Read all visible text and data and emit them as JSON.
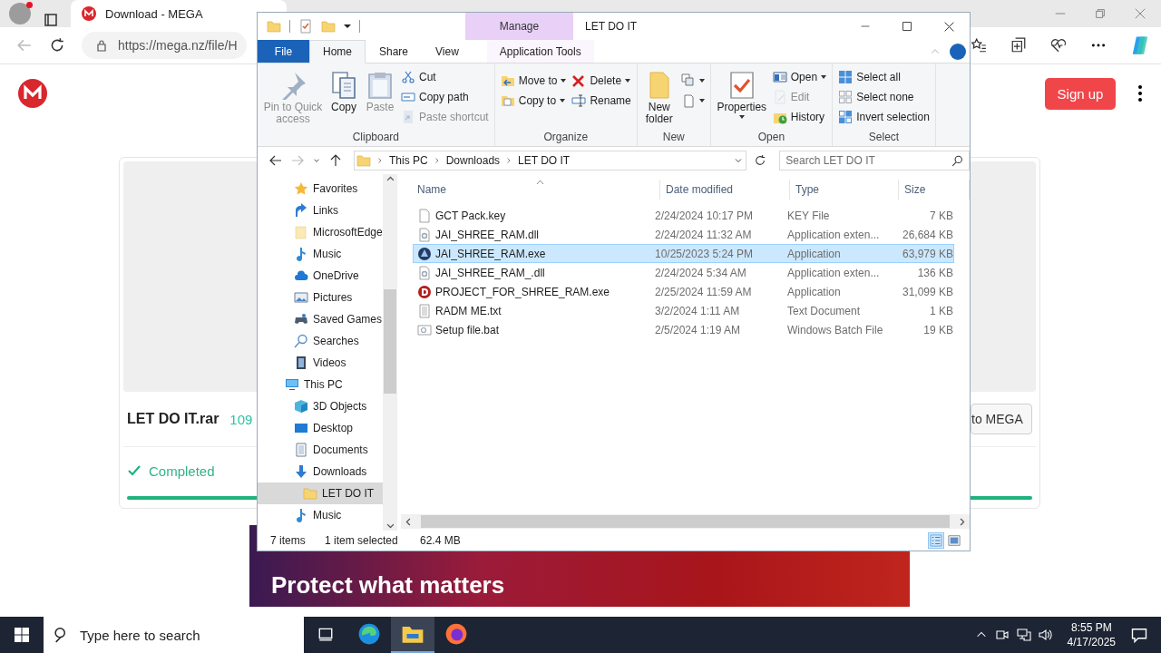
{
  "browser": {
    "tab": {
      "title": "Download - MEGA"
    },
    "address": "https://mega.nz/file/H",
    "page": {
      "signup": "Sign up",
      "file_name": "LET DO IT.rar",
      "file_size": "109",
      "save_button": "to MEGA",
      "status": "Completed",
      "progress": {
        "level": 1
      },
      "banner": "Protect what matters"
    }
  },
  "explorer": {
    "title": "LET DO IT",
    "context_label": "Manage",
    "tabs": [
      {
        "label": "File",
        "kind": "file",
        "selected": false
      },
      {
        "label": "Home",
        "kind": "plain",
        "selected": true
      },
      {
        "label": "Share",
        "kind": "plain",
        "selected": false
      },
      {
        "label": "View",
        "kind": "plain",
        "selected": false
      },
      {
        "label": "Application Tools",
        "kind": "context",
        "selected": false
      }
    ],
    "ribbon": [
      {
        "label": "Clipboard",
        "columns": [
          {
            "kind": "large",
            "items": [
              {
                "label": "Pin to Quick access",
                "kind": "pin",
                "disabled": true,
                "dropdown": false
              }
            ]
          },
          {
            "kind": "large",
            "items": [
              {
                "label": "Copy",
                "kind": "copy",
                "disabled": false,
                "dropdown": false
              }
            ]
          },
          {
            "kind": "large",
            "items": [
              {
                "label": "Paste",
                "kind": "paste",
                "disabled": true,
                "dropdown": false
              }
            ]
          },
          {
            "kind": "stack",
            "items": [
              {
                "label": "Cut",
                "kind": "cut",
                "disabled": false,
                "dropdown": false
              },
              {
                "label": "Copy path",
                "kind": "copypath",
                "disabled": false,
                "dropdown": false
              },
              {
                "label": "Paste shortcut",
                "kind": "pasteshortcut",
                "disabled": true,
                "dropdown": false
              }
            ]
          }
        ]
      },
      {
        "label": "Organize",
        "columns": [
          {
            "kind": "stack",
            "items": [
              {
                "label": "Move to",
                "kind": "moveto",
                "disabled": false,
                "dropdown": true
              },
              {
                "label": "Copy to",
                "kind": "copyto",
                "disabled": false,
                "dropdown": true
              }
            ]
          },
          {
            "kind": "stack",
            "items": [
              {
                "label": "Delete",
                "kind": "delete",
                "disabled": false,
                "dropdown": true
              },
              {
                "label": "Rename",
                "kind": "rename",
                "disabled": false,
                "dropdown": false
              }
            ]
          }
        ]
      },
      {
        "label": "New",
        "columns": [
          {
            "kind": "large",
            "items": [
              {
                "label": "New folder",
                "kind": "newfolder",
                "disabled": false,
                "dropdown": false
              }
            ]
          },
          {
            "kind": "stack",
            "items": [
              {
                "kind": "newitem",
                "disabled": false,
                "dropdown": true
              },
              {
                "kind": "easyaccess",
                "disabled": false,
                "dropdown": true
              }
            ]
          }
        ]
      },
      {
        "label": "Open",
        "columns": [
          {
            "kind": "large",
            "items": [
              {
                "label": "Properties",
                "kind": "properties",
                "disabled": false,
                "dropdown": true
              }
            ]
          },
          {
            "kind": "stack",
            "items": [
              {
                "label": "Open",
                "kind": "open",
                "disabled": false,
                "dropdown": true
              },
              {
                "label": "Edit",
                "kind": "edit",
                "disabled": true,
                "dropdown": false
              },
              {
                "label": "History",
                "kind": "history",
                "disabled": false,
                "dropdown": false
              }
            ]
          }
        ]
      },
      {
        "label": "Select",
        "columns": [
          {
            "kind": "stack",
            "items": [
              {
                "label": "Select all",
                "kind": "selectall",
                "disabled": false,
                "dropdown": false
              },
              {
                "label": "Select none",
                "kind": "selectnone",
                "disabled": false,
                "dropdown": false
              },
              {
                "label": "Invert selection",
                "kind": "invert",
                "disabled": false,
                "dropdown": false
              }
            ]
          }
        ]
      }
    ],
    "breadcrumbs": [
      "This PC",
      "Downloads",
      "LET DO IT"
    ],
    "search": {
      "placeholder": "Search LET DO IT"
    },
    "nav_pane": {
      "partial_group": [
        {
          "label": "Favorites",
          "kind": "star",
          "selected": false
        },
        {
          "label": "Links",
          "kind": "link",
          "selected": false
        },
        {
          "label": "MicrosoftEdge",
          "kind": "folderlight",
          "selected": false
        },
        {
          "label": "Music",
          "kind": "music",
          "selected": false
        },
        {
          "label": "OneDrive",
          "kind": "cloud",
          "selected": false
        },
        {
          "label": "Pictures",
          "kind": "pictures",
          "selected": false
        },
        {
          "label": "Saved Games",
          "kind": "games",
          "selected": false
        },
        {
          "label": "Searches",
          "kind": "searches",
          "selected": false
        },
        {
          "label": "Videos",
          "kind": "video",
          "selected": false
        }
      ],
      "items": [
        {
          "label": "This PC",
          "kind": "pc",
          "selected": false,
          "children": [
            {
              "label": "3D Objects",
              "kind": "cube",
              "selected": false
            },
            {
              "label": "Desktop",
              "kind": "desktop",
              "selected": false
            },
            {
              "label": "Documents",
              "kind": "docs",
              "selected": false
            },
            {
              "label": "Downloads",
              "kind": "downloads",
              "selected": false,
              "children": [
                {
                  "label": "LET DO IT",
                  "kind": "folder",
                  "selected": true
                }
              ]
            },
            {
              "label": "Music",
              "kind": "music",
              "selected": false
            }
          ]
        }
      ]
    },
    "columns": [
      {
        "label": "Name",
        "sorted": true
      },
      {
        "label": "Date modified",
        "sorted": false
      },
      {
        "label": "Type",
        "sorted": false
      },
      {
        "label": "Size",
        "sorted": false
      }
    ],
    "files": [
      {
        "name": "GCT Pack.key",
        "date": "2/24/2024 10:17 PM",
        "type": "KEY File",
        "size": "7 KB",
        "kind": "blank",
        "selected": false
      },
      {
        "name": "JAI_SHREE_RAM.dll",
        "date": "2/24/2024 11:32 AM",
        "type": "Application exten...",
        "size": "26,684 KB",
        "kind": "dll",
        "selected": false
      },
      {
        "name": "JAI_SHREE_RAM.exe",
        "date": "10/25/2023 5:24 PM",
        "type": "Application",
        "size": "63,979 KB",
        "kind": "exe",
        "selected": true
      },
      {
        "name": "JAI_SHREE_RAM_.dll",
        "date": "2/24/2024 5:34 AM",
        "type": "Application exten...",
        "size": "136 KB",
        "kind": "dll",
        "selected": false
      },
      {
        "name": "PROJECT_FOR_SHREE_RAM.exe",
        "date": "2/25/2024 11:59 AM",
        "type": "Application",
        "size": "31,099 KB",
        "kind": "exealt",
        "selected": false
      },
      {
        "name": "RADM ME.txt",
        "date": "3/2/2024 1:11 AM",
        "type": "Text Document",
        "size": "1 KB",
        "kind": "txt",
        "selected": false
      },
      {
        "name": "Setup file.bat",
        "date": "2/5/2024 1:19 AM",
        "type": "Windows Batch File",
        "size": "19 KB",
        "kind": "bat",
        "selected": false
      }
    ],
    "status": {
      "count": "7 items",
      "selection": "1 item selected",
      "size": "62.4 MB"
    },
    "views": [
      {
        "kind": "details",
        "selected": true
      },
      {
        "kind": "large",
        "selected": false
      }
    ]
  },
  "taskbar": {
    "search": {
      "placeholder": "Type here to search"
    },
    "apps": [
      {
        "kind": "taskview",
        "active": false
      },
      {
        "kind": "edge",
        "active": false
      },
      {
        "kind": "explorer",
        "active": true
      },
      {
        "kind": "firefox",
        "active": false
      }
    ],
    "time": "8:55 PM",
    "date": "4/17/2025"
  }
}
